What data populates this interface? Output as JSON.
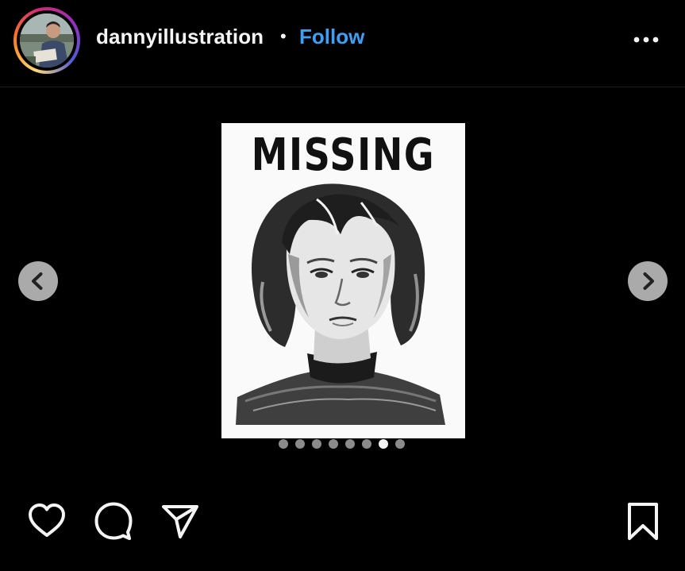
{
  "header": {
    "username": "dannyillustration",
    "separator": "•",
    "follow_label": "Follow",
    "more_icon": "more-horizontal-icon"
  },
  "media": {
    "image_text": "MISSING",
    "image_subject": "pencil-sketch-portrait-woman",
    "carousel": {
      "total": 8,
      "current": 7
    }
  },
  "actions": {
    "like_icon": "heart-icon",
    "comment_icon": "comment-icon",
    "share_icon": "send-icon",
    "save_icon": "bookmark-icon"
  },
  "colors": {
    "background": "#000000",
    "accent": "#3f9ff5",
    "dot_inactive": "#8b8b8b",
    "dot_active": "#f5f5f5"
  }
}
